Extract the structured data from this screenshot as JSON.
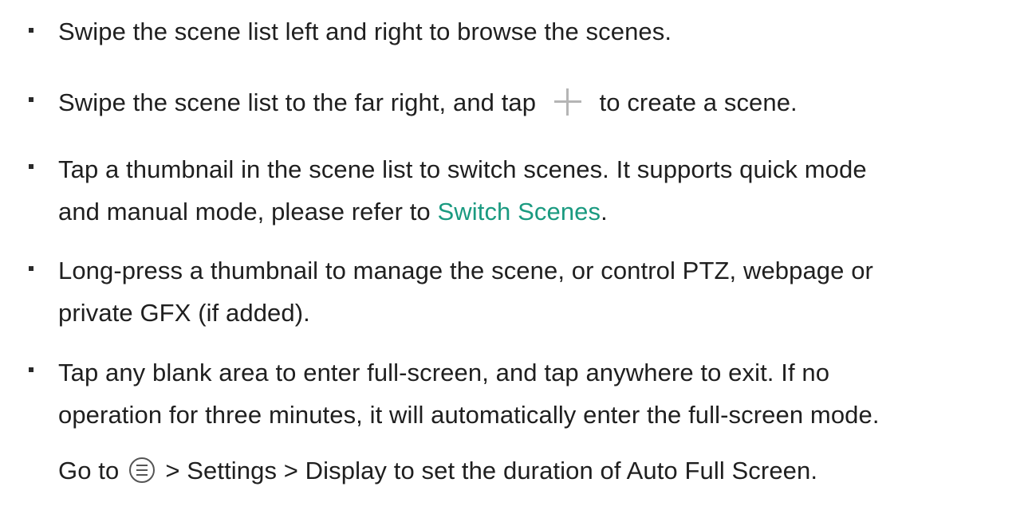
{
  "items": [
    {
      "lines": [
        "Swipe the scene list left and right to browse the scenes."
      ]
    },
    {
      "before_icon": "Swipe the scene list to the far right, and tap",
      "icon": "plus-icon",
      "after_icon": "to create a scene."
    },
    {
      "line1": "Tap a thumbnail in the scene list to switch scenes. It supports quick mode",
      "line2_before_link": "and manual mode, please refer to ",
      "link": "Switch Scenes",
      "line2_after_link": "."
    },
    {
      "line1": "Long-press a thumbnail to manage the scene, or control PTZ, webpage or",
      "line2": "private GFX (if added)."
    },
    {
      "line1": "Tap any blank area to enter full-screen, and tap anywhere to exit. If no",
      "line2": "operation for three minutes, it will automatically enter the full-screen mode.",
      "line3_before_icon": "Go to",
      "icon": "menu-circle-icon",
      "line3_after_icon": "> Settings > Display to set the duration of Auto Full Screen."
    }
  ],
  "colors": {
    "text": "#1f1f1f",
    "link": "#1a9a80",
    "icon": "#b5b5b5"
  }
}
